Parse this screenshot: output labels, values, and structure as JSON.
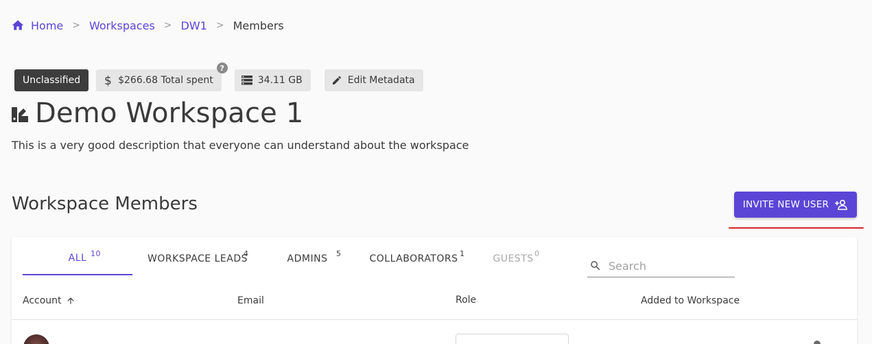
{
  "breadcrumb": {
    "home": "Home",
    "workspaces": "Workspaces",
    "workspace": "DW1",
    "current": "Members",
    "separator": ">"
  },
  "chips": {
    "classification": "Unclassified",
    "spent": "$266.68 Total spent",
    "help": "?",
    "storage": "34.11 GB",
    "edit": "Edit Metadata"
  },
  "workspace": {
    "title": "Demo Workspace 1",
    "description": "This is a very good description that everyone can understand about the workspace"
  },
  "members": {
    "heading": "Workspace Members",
    "invite_label": "INVITE NEW USER",
    "tabs": [
      {
        "label": "ALL",
        "count": "10"
      },
      {
        "label": "WORKSPACE LEADS",
        "count": "4"
      },
      {
        "label": "ADMINS",
        "count": "5"
      },
      {
        "label": "COLLABORATORS",
        "count": "1"
      },
      {
        "label": "GUESTS",
        "count": "0"
      }
    ],
    "search_placeholder": "Search",
    "columns": {
      "account": "Account",
      "email": "Email",
      "role": "Role",
      "added": "Added to Workspace"
    }
  },
  "colors": {
    "accent": "#5b45d6",
    "highlight": "#d42a2a"
  },
  "icons": [
    "home-icon",
    "dollar-icon",
    "storage-icon",
    "edit-icon",
    "workspace-icon",
    "person-add-icon",
    "search-icon",
    "arrow-up-icon"
  ]
}
